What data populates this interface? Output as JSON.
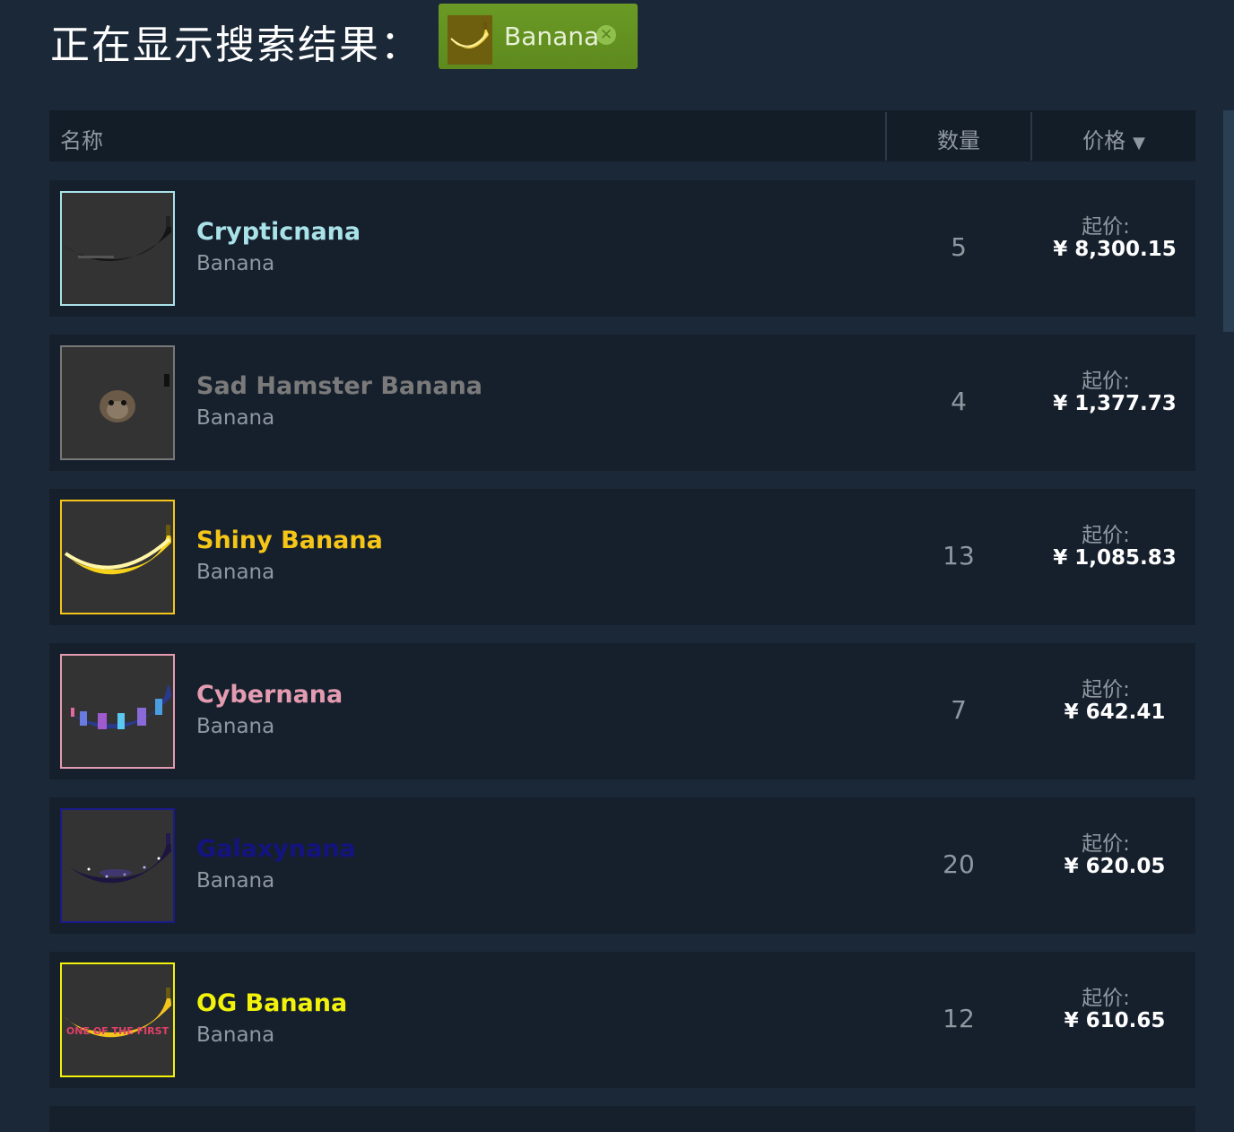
{
  "header": {
    "search_label": "正在显示搜索结果：",
    "filter": {
      "label": "Banana",
      "close_icon": "x-circle-icon"
    }
  },
  "table": {
    "col_name": "名称",
    "col_qty": "数量",
    "col_price": "价格",
    "sort_icon": "▼"
  },
  "rows": [
    {
      "name": "Crypticnana",
      "type": "Banana",
      "qty": "5",
      "price_label": "起价:",
      "price": "¥ 8,300.15",
      "color": "#a9e2e8",
      "icon": "black-banana-icon"
    },
    {
      "name": "Sad Hamster Banana",
      "type": "Banana",
      "qty": "4",
      "price_label": "起价:",
      "price": "¥ 1,377.73",
      "color": "#7a7a7a",
      "icon": "hamster-banana-icon"
    },
    {
      "name": "Shiny Banana",
      "type": "Banana",
      "qty": "13",
      "price_label": "起价:",
      "price": "¥ 1,085.83",
      "color": "#f5c518",
      "icon": "yellow-banana-icon"
    },
    {
      "name": "Cybernana",
      "type": "Banana",
      "qty": "7",
      "price_label": "起价:",
      "price": "¥ 642.41",
      "color": "#e39bb0",
      "icon": "cyber-banana-icon"
    },
    {
      "name": "Galaxynana",
      "type": "Banana",
      "qty": "20",
      "price_label": "起价:",
      "price": "¥ 620.05",
      "color": "#141480",
      "icon": "galaxy-banana-icon"
    },
    {
      "name": "OG Banana",
      "type": "Banana",
      "qty": "12",
      "price_label": "起价:",
      "price": "¥ 610.65",
      "color": "#f2f20a",
      "icon": "og-banana-icon",
      "banana_text": "ONE OF THE FIRST"
    }
  ]
}
